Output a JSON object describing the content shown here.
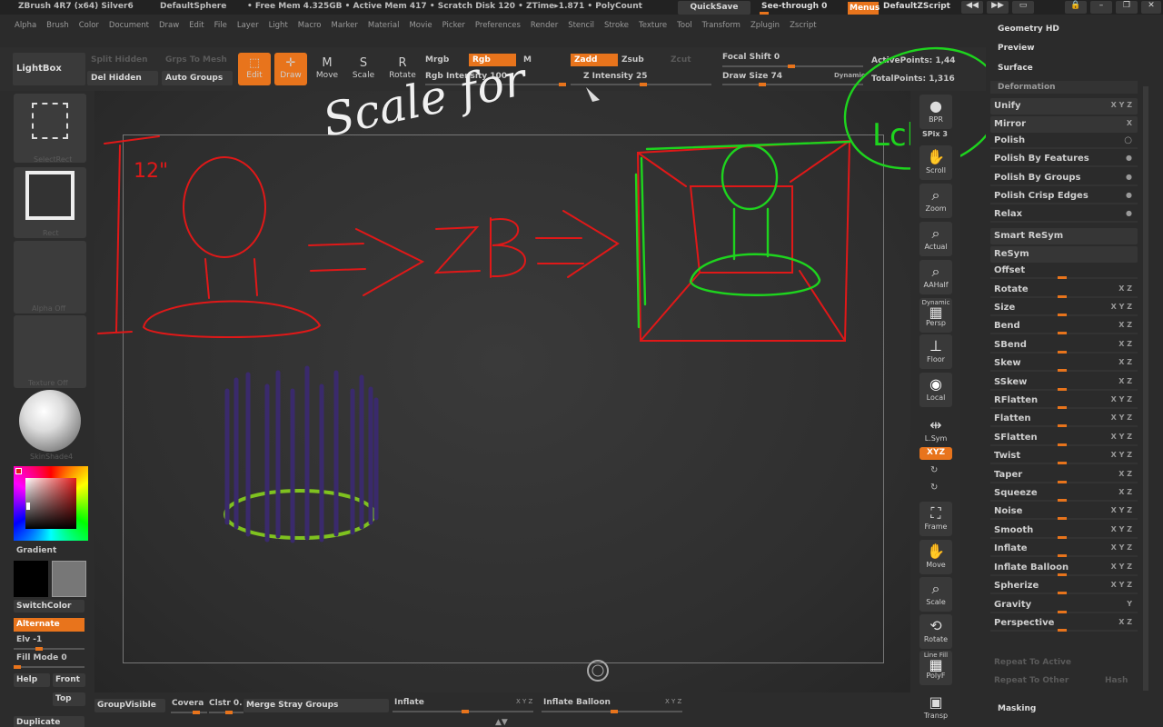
{
  "titlebar": {
    "app": "ZBrush 4R7 (x64) Silver6",
    "project": "DefaultSphere",
    "mem": "• Free Mem 4.325GB • Active Mem 417 • Scratch Disk 120 • ZTime▸1.871 • PolyCount",
    "quicksave": "QuickSave",
    "seethrough": "See-through 0",
    "menus": "Menus",
    "zscript": "DefaultZScript"
  },
  "menubar": [
    "Alpha",
    "Brush",
    "Color",
    "Document",
    "Draw",
    "Edit",
    "File",
    "Layer",
    "Light",
    "Macro",
    "Marker",
    "Material",
    "Movie",
    "Picker",
    "Preferences",
    "Render",
    "Stencil",
    "Stroke",
    "Texture",
    "Tool",
    "Transform",
    "Zplugin",
    "Zscript"
  ],
  "topshelf": {
    "lightbox": "LightBox",
    "split_hidden": "Split Hidden",
    "groups_to_mesh": "Grps To Mesh",
    "del_hidden": "Del Hidden",
    "auto_groups": "Auto Groups",
    "edit": "Edit",
    "draw": "Draw",
    "move": "Move",
    "scale": "Scale",
    "rotate": "Rotate",
    "mrgb": "Mrgb",
    "rgb": "Rgb",
    "m": "M",
    "rgb_intensity": "Rgb Intensity 100",
    "zadd": "Zadd",
    "zsub": "Zsub",
    "zcut": "Zcut",
    "z_intensity": "Z Intensity 25",
    "focal_shift": "Focal Shift 0",
    "draw_size": "Draw Size 74",
    "dynamic": "Dynamic",
    "active_points": "ActivePoints: 1,44",
    "total_points": "TotalPoints: 1,316"
  },
  "leftshelf": {
    "select_rect": "SelectRect",
    "rect": "Rect",
    "alpha_off": "Alpha Off",
    "texture_off": "Texture Off",
    "material": "SkinShade4",
    "gradient": "Gradient",
    "switchcolor": "SwitchColor",
    "alternate": "Alternate",
    "elv": "Elv -1",
    "fill_mode": "Fill Mode 0",
    "help": "Help",
    "front": "Front",
    "top": "Top",
    "duplicate": "Duplicate"
  },
  "rightshelf": {
    "bpr": "BPR",
    "spix": "SPix 3",
    "scroll": "Scroll",
    "zoom": "Zoom",
    "actual": "Actual",
    "aahalf": "AAHalf",
    "dynamic": "Dynamic",
    "persp": "Persp",
    "floor": "Floor",
    "local": "Local",
    "lsym": "L.Sym",
    "xyz": "XYZ",
    "frame": "Frame",
    "move": "Move",
    "scale": "Scale",
    "rotate": "Rotate",
    "linefill": "Line Fill",
    "polyf": "PolyF",
    "transp": "Transp"
  },
  "tray": {
    "geometry_hd": "Geometry HD",
    "preview": "Preview",
    "surface": "Surface",
    "deformation": "Deformation",
    "unify": "Unify",
    "mirror": "Mirror",
    "polish": "Polish",
    "polish_features": "Polish By Features",
    "polish_groups": "Polish By Groups",
    "polish_crisp": "Polish Crisp Edges",
    "relax": "Relax",
    "smart_resym": "Smart ReSym",
    "resym": "ReSym",
    "items": [
      "Offset",
      "Rotate",
      "Size",
      "Bend",
      "SBend",
      "Skew",
      "SSkew",
      "RFlatten",
      "Flatten",
      "SFlatten",
      "Twist",
      "Taper",
      "Squeeze",
      "Noise",
      "Smooth",
      "Inflate",
      "Inflate Balloon",
      "Spherize",
      "Gravity",
      "Perspective"
    ],
    "repeat_active": "Repeat To Active",
    "repeat_other": "Repeat To Other",
    "hash": "Hash",
    "masking": "Masking"
  },
  "bottom": {
    "groupvisible": "GroupVisible",
    "covera": "Covera",
    "clstr": "Clstr 0.",
    "merge_stray": "Merge Stray Groups",
    "inflate": "Inflate",
    "inflate_balloon": "Inflate Balloon"
  },
  "annotations": {
    "scale_for": "Scale for",
    "dim12": "12\"",
    "arrow_text": "⇒ZB⇒",
    "lcl": "Lcl"
  },
  "colors": {
    "accent": "#e8741c",
    "sketch_red": "#e01818",
    "sketch_green": "#1ed41e"
  }
}
